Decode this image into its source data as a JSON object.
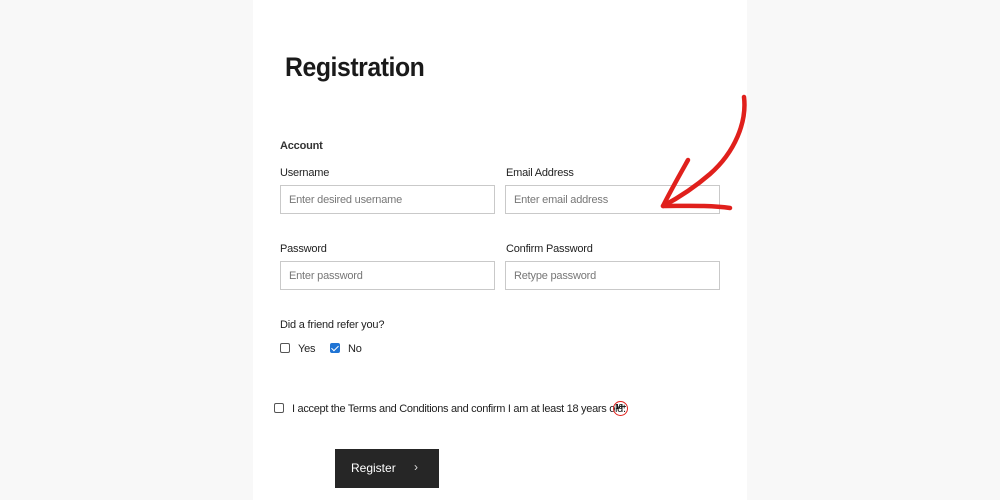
{
  "page": {
    "title": "Registration",
    "section_label": "Account"
  },
  "fields": {
    "username": {
      "label": "Username",
      "placeholder": "Enter desired username",
      "value": ""
    },
    "email": {
      "label": "Email Address",
      "placeholder": "Enter email address",
      "value": ""
    },
    "password": {
      "label": "Password",
      "placeholder": "Enter password",
      "value": ""
    },
    "confirm_password": {
      "label": "Confirm Password",
      "placeholder": "Retype password",
      "value": ""
    }
  },
  "referral": {
    "question": "Did a friend refer you?",
    "options": [
      {
        "label": "Yes",
        "checked": false
      },
      {
        "label": "No",
        "checked": true
      }
    ]
  },
  "terms": {
    "text": "I accept the Terms and Conditions and confirm I am at least 18 years old.",
    "checked": false,
    "age_badge": "18+"
  },
  "submit": {
    "label": "Register",
    "icon": "chevron-right-icon"
  },
  "colors": {
    "button_bg": "#262626",
    "checkbox_checked": "#1f74d4",
    "annotation_arrow": "#e0201c",
    "age_badge_ring": "#e0201c"
  }
}
